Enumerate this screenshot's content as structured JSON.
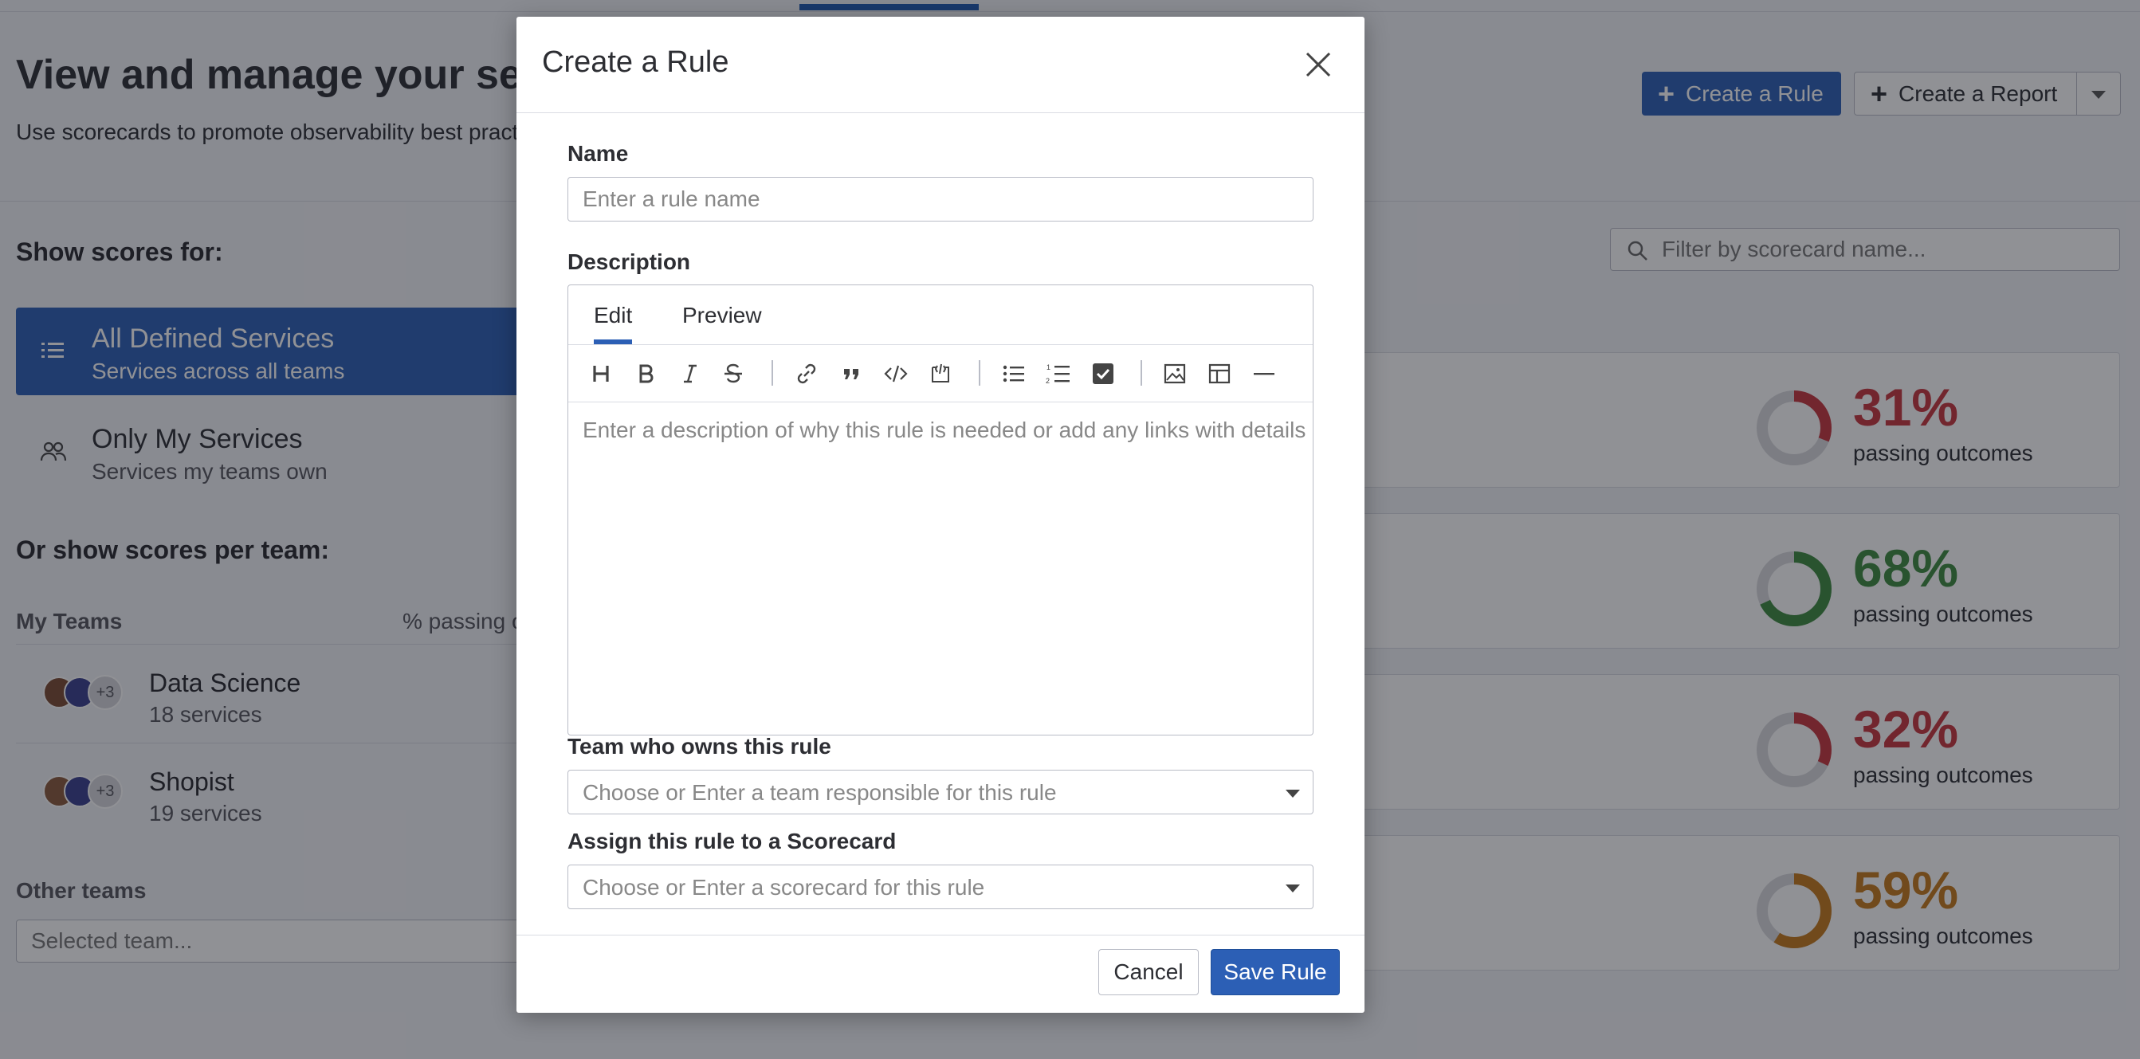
{
  "background": {
    "title": "View and manage your services",
    "subtitle": "Use scorecards to promote observability best practices",
    "create_rule_label": "Create a Rule",
    "create_report_label": "Create a Report",
    "show_scores_for": "Show scores for:",
    "filter_placeholder": "Filter by scorecard name...",
    "service_options": [
      {
        "title": "All Defined Services",
        "subtitle": "Services across all teams"
      },
      {
        "title": "Only My Services",
        "subtitle": "Services my teams own"
      }
    ],
    "per_team_heading": "Or show scores per team:",
    "my_teams_label": "My Teams",
    "pct_column_label": "% passing outcomes",
    "teams": [
      {
        "name": "Data Science",
        "services": "18 services",
        "extra_members": "+3"
      },
      {
        "name": "Shopist",
        "services": "19 services",
        "extra_members": "+3"
      }
    ],
    "other_teams_label": "Other teams",
    "team_select_placeholder": "Selected team...",
    "scorecards": [
      {
        "percent": "31%",
        "label": "passing outcomes",
        "value": 0.31,
        "color": "#c6353d"
      },
      {
        "percent": "68%",
        "label": "passing outcomes",
        "value": 0.68,
        "color": "#3d8a3f"
      },
      {
        "percent": "32%",
        "label": "passing outcomes",
        "value": 0.32,
        "color": "#c6353d"
      },
      {
        "percent": "59%",
        "label": "passing outcomes",
        "value": 0.59,
        "color": "#c4791b"
      }
    ],
    "colors": {
      "accent": "#2c5fb5",
      "overlay": "rgba(20,22,30,0.47)"
    }
  },
  "modal": {
    "title": "Create a Rule",
    "name_label": "Name",
    "name_placeholder": "Enter a rule name",
    "description_label": "Description",
    "tabs": [
      {
        "label": "Edit",
        "active": true
      },
      {
        "label": "Preview",
        "active": false
      }
    ],
    "toolbar_icons": [
      "heading-icon",
      "bold-icon",
      "italic-icon",
      "strikethrough-icon",
      "link-icon",
      "quote-icon",
      "code-icon",
      "code-block-icon",
      "bullet-list-icon",
      "numbered-list-icon",
      "task-list-icon",
      "image-icon",
      "table-icon",
      "horizontal-rule-icon"
    ],
    "description_placeholder": "Enter a description of why this rule is needed or add any links with details",
    "team_label": "Team who owns this rule",
    "team_placeholder": "Choose or Enter a team responsible for this rule",
    "scorecard_label": "Assign this rule to a Scorecard",
    "scorecard_placeholder": "Choose or Enter a scorecard for this rule",
    "cancel_label": "Cancel",
    "save_label": "Save Rule"
  }
}
